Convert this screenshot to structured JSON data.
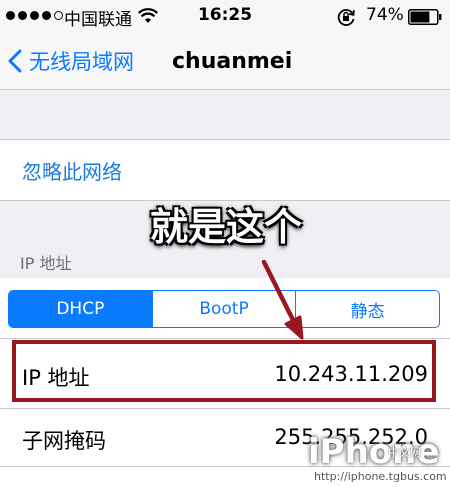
{
  "status_bar": {
    "signal_bars": 4,
    "signal_max": 5,
    "carrier": "中国联通",
    "time": "16:25",
    "battery": "74%",
    "battery_level": 0.74
  },
  "nav": {
    "back_label": "无线局域网",
    "title": "chuanmei"
  },
  "forget_network": "忽略此网络",
  "section_header": "IP 地址",
  "segments": [
    "DHCP",
    "BootP",
    "静态"
  ],
  "selected_segment": "DHCP",
  "rows": [
    {
      "label": "IP 地址",
      "value": "10.243.11.209"
    },
    {
      "label": "子网掩码",
      "value": "255.255.252.0"
    }
  ],
  "annotation": {
    "callout": "就是这个",
    "color": "#9b1720"
  },
  "watermark": {
    "logo": "iPhone",
    "sub": "中文网",
    "url": "http://iphone.tgbus.com"
  },
  "colors": {
    "accent": "#0a7aff",
    "link": "#1f7ad6",
    "background": "#efeff4",
    "annotation": "#9b1720"
  },
  "icons": [
    "signal-dots-icon",
    "wifi-icon",
    "rotation-lock-icon",
    "battery-icon",
    "back-chevron-icon",
    "arrow-icon"
  ]
}
